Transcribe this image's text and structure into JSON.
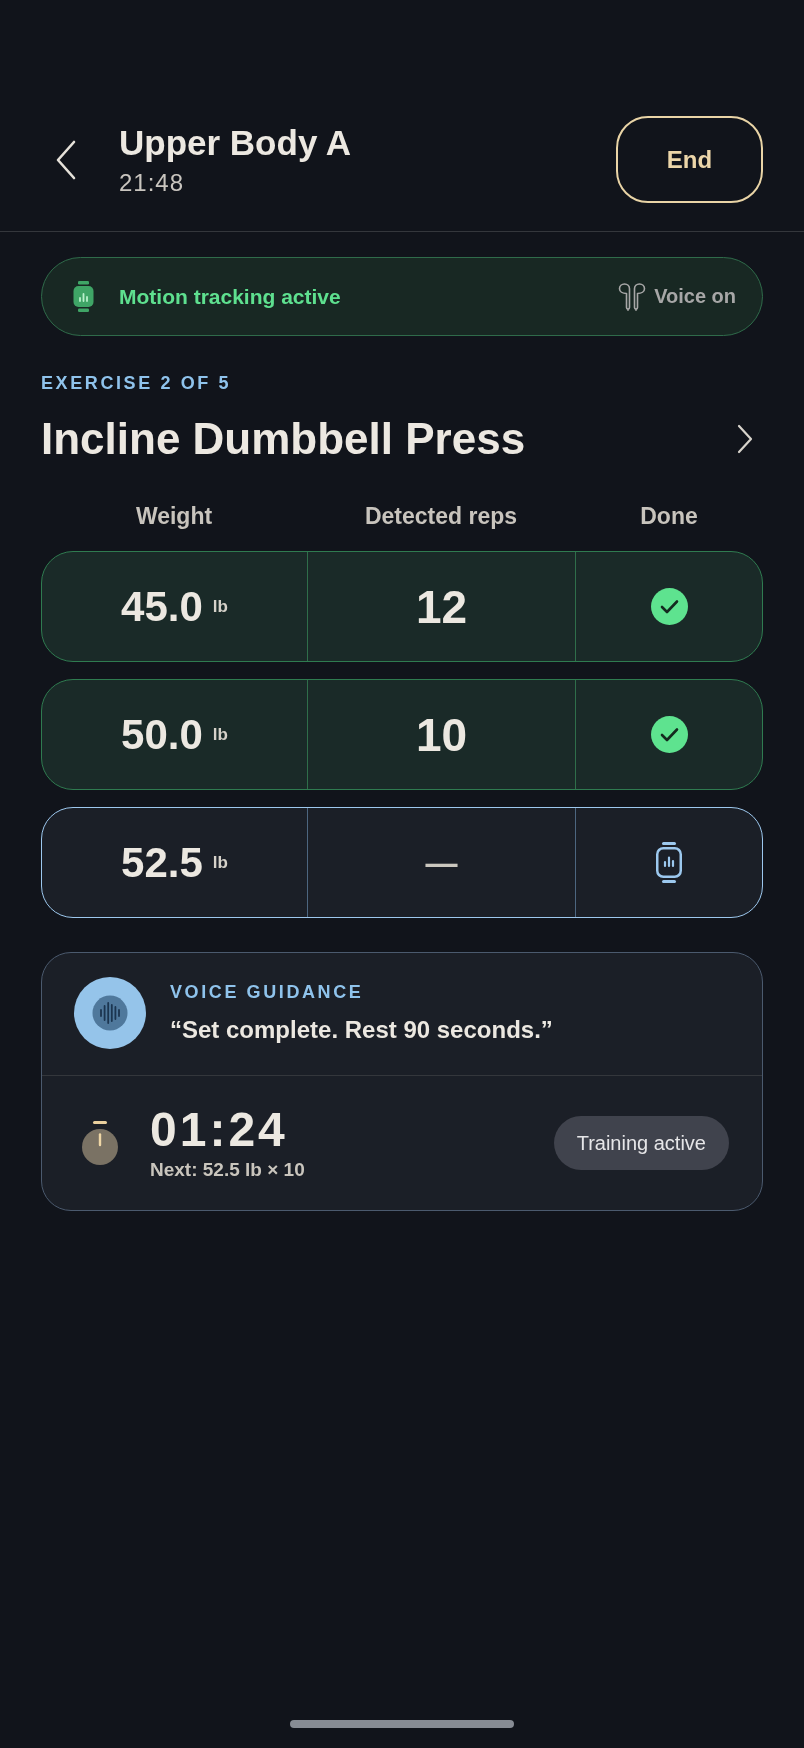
{
  "header": {
    "title": "Upper Body A",
    "elapsed": "21:48",
    "end_button": "End"
  },
  "tracking_banner": {
    "label": "Motion tracking active",
    "voice_label": "Voice on"
  },
  "exercise": {
    "counter": "EXERCISE 2 OF 5",
    "name": "Incline Dumbbell Press"
  },
  "sets_table": {
    "columns": [
      "Weight",
      "Detected reps",
      "Done"
    ],
    "rows": [
      {
        "weight": "45.0",
        "unit": "lb",
        "reps": "12",
        "done": true,
        "selected": false
      },
      {
        "weight": "50.0",
        "unit": "lb",
        "reps": "10",
        "done": true,
        "selected": false
      },
      {
        "weight": "52.5",
        "unit": "lb",
        "reps": "—",
        "done": false,
        "selected": true
      }
    ]
  },
  "voice_guidance": {
    "label": "VOICE GUIDANCE",
    "message": "“Set complete. Rest 90 seconds.”"
  },
  "rest_timer": {
    "time": "01:24",
    "next": "Next: 52.5 lb × 10",
    "status": "Training active"
  }
}
